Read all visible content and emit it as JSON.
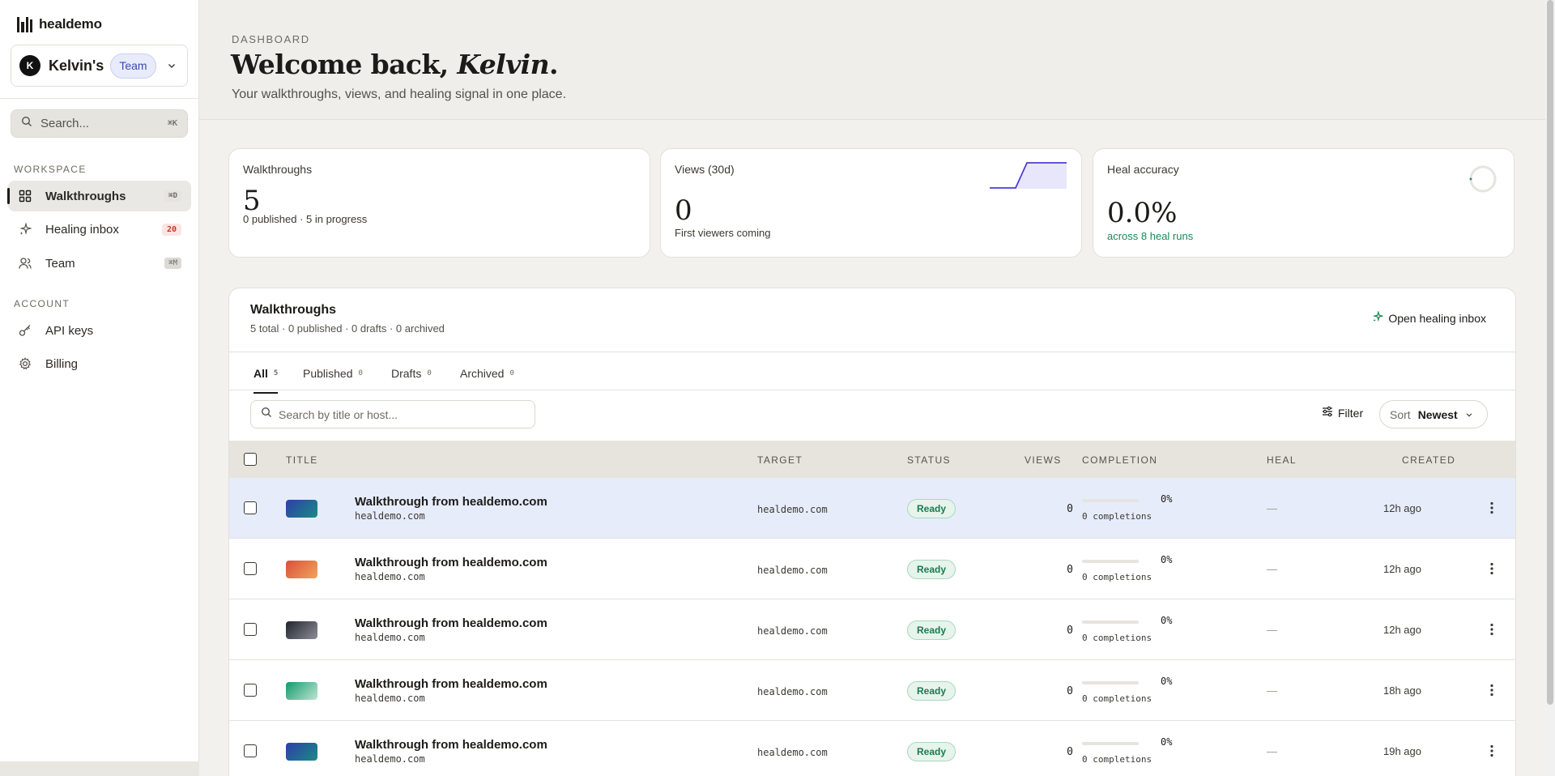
{
  "brand": {
    "name": "healdemo"
  },
  "workspace": {
    "avatar_initial": "K",
    "name": "Kelvin's",
    "badge": "Team"
  },
  "sidebar": {
    "search": {
      "label": "Search...",
      "shortcut": "⌘K"
    },
    "workspace_label": "WORKSPACE",
    "account_label": "ACCOUNT",
    "items": [
      {
        "label": "Walkthroughs",
        "icon": "grid-icon",
        "shortcut": "⌘D",
        "active": true
      },
      {
        "label": "Healing inbox",
        "icon": "sparkle-icon",
        "count": "20"
      },
      {
        "label": "Team",
        "icon": "users-icon",
        "shortcut": "⌘M"
      },
      {
        "label": "API keys",
        "icon": "key-icon"
      },
      {
        "label": "Billing",
        "icon": "gear-icon"
      }
    ]
  },
  "header": {
    "eyebrow": "DASHBOARD",
    "welcome_prefix": "Welcome back, ",
    "welcome_name": "Kelvin",
    "welcome_suffix": ".",
    "subtitle": "Your walkthroughs, views, and healing signal in one place."
  },
  "stats": {
    "walkthroughs": {
      "label": "Walkthroughs",
      "value": "5",
      "sub": "0 published · 5 in progress"
    },
    "views": {
      "label": "Views (30d)",
      "value": "0",
      "sub": "First viewers coming"
    },
    "heal": {
      "label": "Heal accuracy",
      "value": "0.0%",
      "sub": "across 8 heal runs"
    }
  },
  "colors": {
    "accent": "#4a3fd6",
    "status_green": "#1a7a4f",
    "alert_red": "#c0392b"
  },
  "panel": {
    "title": "Walkthroughs",
    "subtitle": "5 total · 0 published · 0 drafts · 0 archived",
    "open_inbox_label": "Open healing inbox",
    "tabs": [
      {
        "label": "All",
        "count": "5",
        "active": true
      },
      {
        "label": "Published",
        "count": "0"
      },
      {
        "label": "Drafts",
        "count": "0"
      },
      {
        "label": "Archived",
        "count": "0"
      }
    ],
    "search_placeholder": "Search by title or host...",
    "filter_label": "Filter",
    "sort_label": "Sort",
    "sort_value": "Newest",
    "columns": {
      "title": "TITLE",
      "target": "TARGET",
      "status": "STATUS",
      "views": "VIEWS",
      "completion": "COMPLETION",
      "heal": "HEAL",
      "created": "CREATED"
    },
    "rows": [
      {
        "title": "Walkthrough from healdemo.com",
        "host": "healdemo.com",
        "target": "healdemo.com",
        "status": "Ready",
        "views": "0",
        "completion_pct": "0%",
        "completion_fraction": 0,
        "completions": "0 completions",
        "heal": "—",
        "created": "12h ago",
        "thumb_colors": [
          "#2d3fa8",
          "#1b8a86"
        ]
      },
      {
        "title": "Walkthrough from healdemo.com",
        "host": "healdemo.com",
        "target": "healdemo.com",
        "status": "Ready",
        "views": "0",
        "completion_pct": "0%",
        "completion_fraction": 0,
        "completions": "0 completions",
        "heal": "—",
        "created": "12h ago",
        "thumb_colors": [
          "#d9503a",
          "#f0a55a"
        ]
      },
      {
        "title": "Walkthrough from healdemo.com",
        "host": "healdemo.com",
        "target": "healdemo.com",
        "status": "Ready",
        "views": "0",
        "completion_pct": "0%",
        "completion_fraction": 0,
        "completions": "0 completions",
        "heal": "—",
        "created": "12h ago",
        "thumb_colors": [
          "#23252b",
          "#8a8e99"
        ]
      },
      {
        "title": "Walkthrough from healdemo.com",
        "host": "healdemo.com",
        "target": "healdemo.com",
        "status": "Ready",
        "views": "0",
        "completion_pct": "0%",
        "completion_fraction": 0,
        "completions": "0 completions",
        "heal": "—",
        "created": "18h ago",
        "thumb_colors": [
          "#129a6f",
          "#bfe5d2"
        ]
      },
      {
        "title": "Walkthrough from healdemo.com",
        "host": "healdemo.com",
        "target": "healdemo.com",
        "status": "Ready",
        "views": "0",
        "completion_pct": "0%",
        "completion_fraction": 0,
        "completions": "0 completions",
        "heal": "—",
        "created": "19h ago",
        "thumb_colors": [
          "#2d3fa8",
          "#1b8a86"
        ]
      }
    ]
  }
}
